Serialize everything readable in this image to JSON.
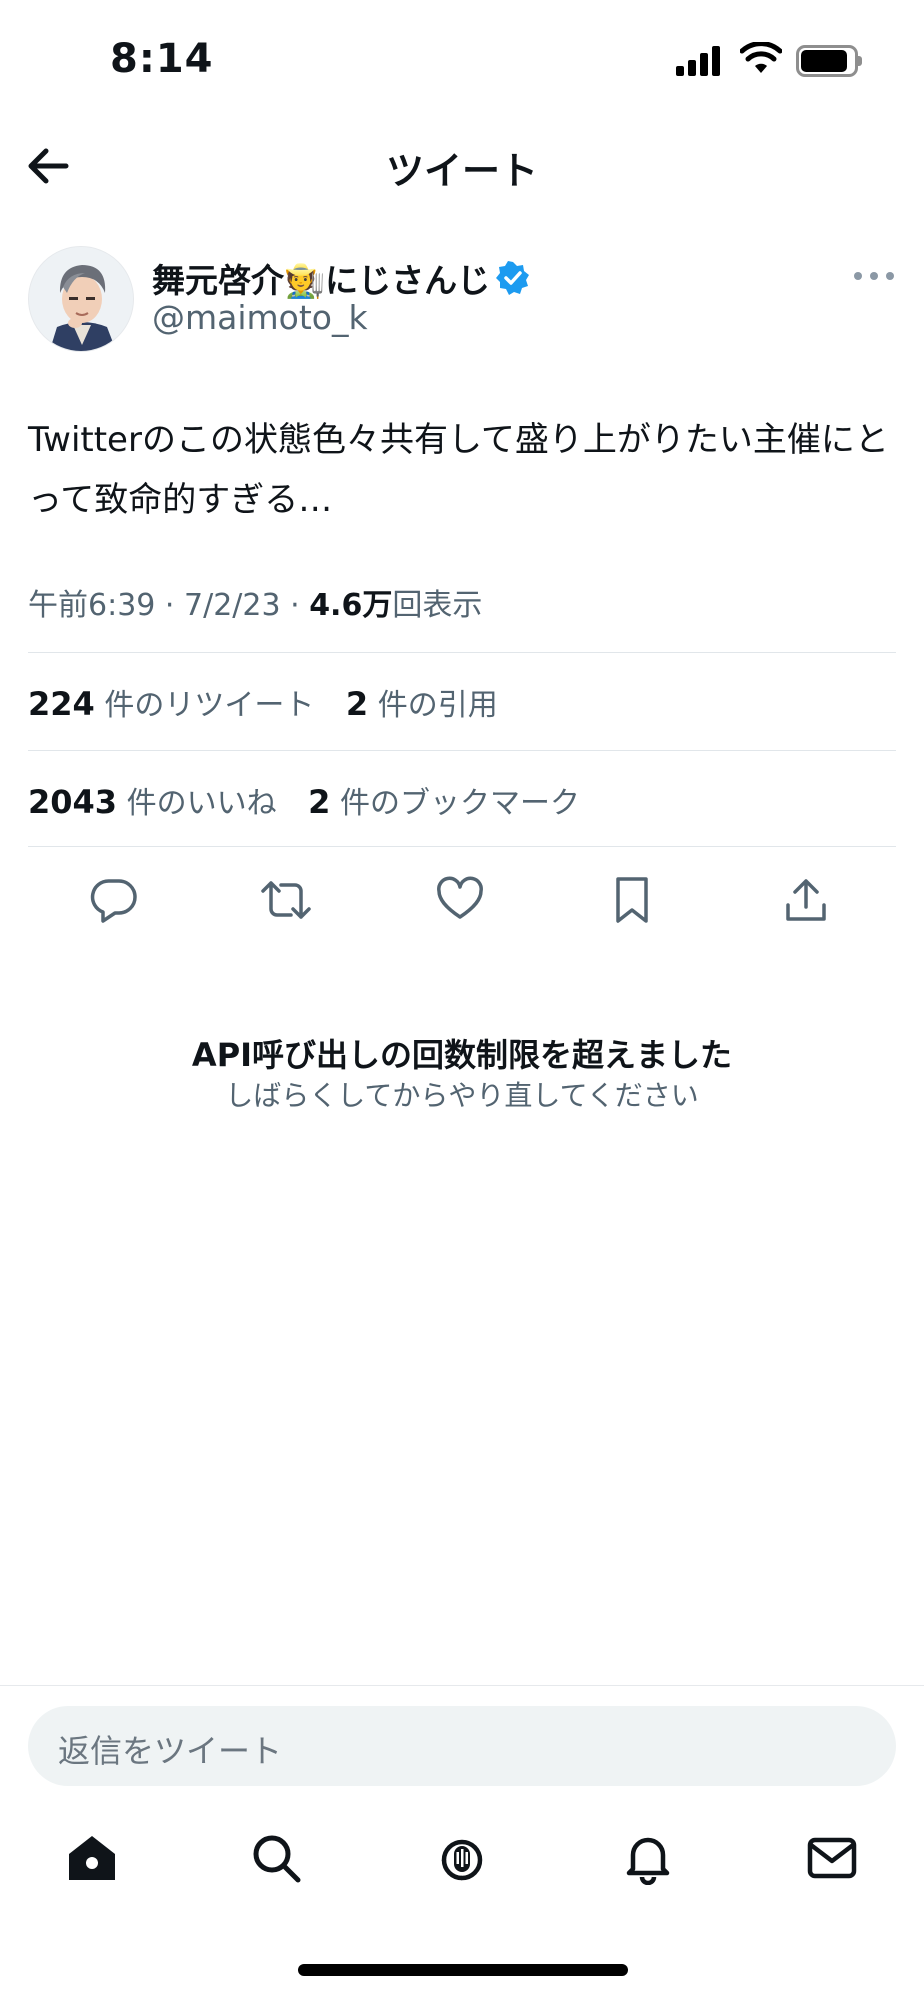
{
  "status_bar": {
    "time": "8:14"
  },
  "header": {
    "title": "ツイート"
  },
  "tweet": {
    "author_name": "舞元啓介🧑‍🌾にじさんじ",
    "author_handle": "@maimoto_k",
    "text": "Twitterのこの状態色々共有して盛り上がりたい主催にとって致命的すぎる…",
    "time": "午前6:39",
    "date": "7/2/23",
    "views_count": "4.6万",
    "views_label": "回表示",
    "retweets_count": "224",
    "retweets_label": "件のリツイート",
    "quotes_count": "2",
    "quotes_label": "件の引用",
    "likes_count": "2043",
    "likes_label": "件のいいね",
    "bookmarks_count": "2",
    "bookmarks_label": "件のブックマーク"
  },
  "error": {
    "title": "API呼び出しの回数制限を超えました",
    "subtitle": "しばらくしてからやり直してください"
  },
  "reply": {
    "placeholder": "返信をツイート"
  },
  "icons": {
    "verified_color": "#1d9bf0",
    "tabs": [
      "home-icon",
      "search-icon",
      "spaces-icon",
      "notifications-icon",
      "messages-icon"
    ],
    "actions": [
      "reply-icon",
      "retweet-icon",
      "like-icon",
      "bookmark-icon",
      "share-icon"
    ]
  }
}
